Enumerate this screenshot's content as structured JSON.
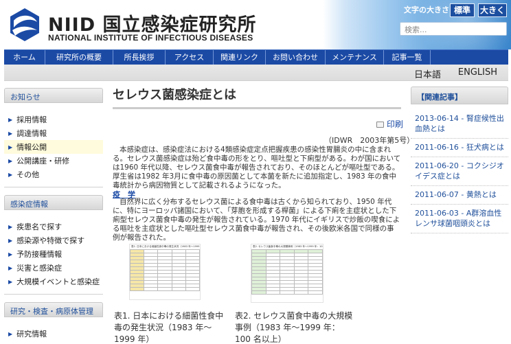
{
  "header": {
    "logo_jp": "NIID 国立感染症研究所",
    "logo_en": "NATIONAL INSTITUTE OF INFECTIOUS DISEASES",
    "font_size_label": "文字の大きさ",
    "font_normal": "標準",
    "font_large": "大きく",
    "search_placeholder": "検索..."
  },
  "nav": [
    "ホーム",
    "研究所の概要",
    "所長挨拶",
    "アクセス",
    "関連リンク",
    "お問い合わせ",
    "メンテナンス",
    "記事一覧"
  ],
  "language": {
    "jp": "日本語",
    "en": "ENGLISH"
  },
  "sidebar": {
    "news_title": "お知らせ",
    "news_items": [
      "採用情報",
      "調達情報",
      "情報公開",
      "公開講座・研修",
      "その他"
    ],
    "disease_title": "感染症情報",
    "disease_items": [
      "疾患名で探す",
      "感染源や特徴で探す",
      "予防接種情報",
      "災害と感染症",
      "大規模イベントと感染症"
    ],
    "research_title": "研究・検査・病原体管理",
    "research_items": [
      "研究情報"
    ]
  },
  "article": {
    "title": "セレウス菌感染症とは",
    "print": "印刷",
    "source": "（IDWR　2003年第5号）",
    "para1": "本感染症は、感染症法における4類感染症定点把握疾患の感染性胃腸炎の中に含まれる。セレウス菌感染症は殆ど食中毒の形をとり、嘔吐型と下痢型がある。わが国においては1960 年代以降、セレウス菌食中毒が報告されており、そのほとんどが嘔吐型である。厚生省は1982 年3月に食中毒の原因菌として本菌を新たに追加指定し、1983 年の食中毒統計から病因物質として記載されるようになった。",
    "section": "疫　学",
    "para2": "自然界に広く分布するセレウス菌による食中毒は古くから知られており、1950 年代に、特にヨーロッパ諸国において、「芽胞を形成する桿菌」による下痢を主症状とした下痢型セレウス菌食中毒の発生が報告されている。1970 年代にイギリスで炒飯の喫食による嘔吐を主症状とした嘔吐型セレウス菌食中毒が報告され、その後欧米各国で同様の事例が報告された。",
    "fig1_title": "表1. 日本における細菌性食中毒の発生状況（1983 年〜1999 年）",
    "fig2_title": "表2. セレウス菌食中毒の大規模事例（1983 年〜1999 年：100 名以上）",
    "caption1": "表1. 日本における細菌性食中毒の発生状況（1983 年〜1999 年）",
    "caption2": "表2. セレウス菌食中毒の大規模事例（1983 年〜1999 年：100 名以上）"
  },
  "related": {
    "title": "【関連記事】",
    "items": [
      "2013-06-14 - 腎症候性出血熱とは",
      "2011-06-16 - 狂犬病とは",
      "2011-06-20 - コクシジオイデス症とは",
      "2011-06-07 - 黄熱とは",
      "2011-06-03 - A群溶血性レンサ球菌咽頭炎とは"
    ]
  },
  "colors": {
    "nav": "#1b4aa5",
    "link": "#1f4f9a",
    "active_item": "#fffbdc"
  }
}
